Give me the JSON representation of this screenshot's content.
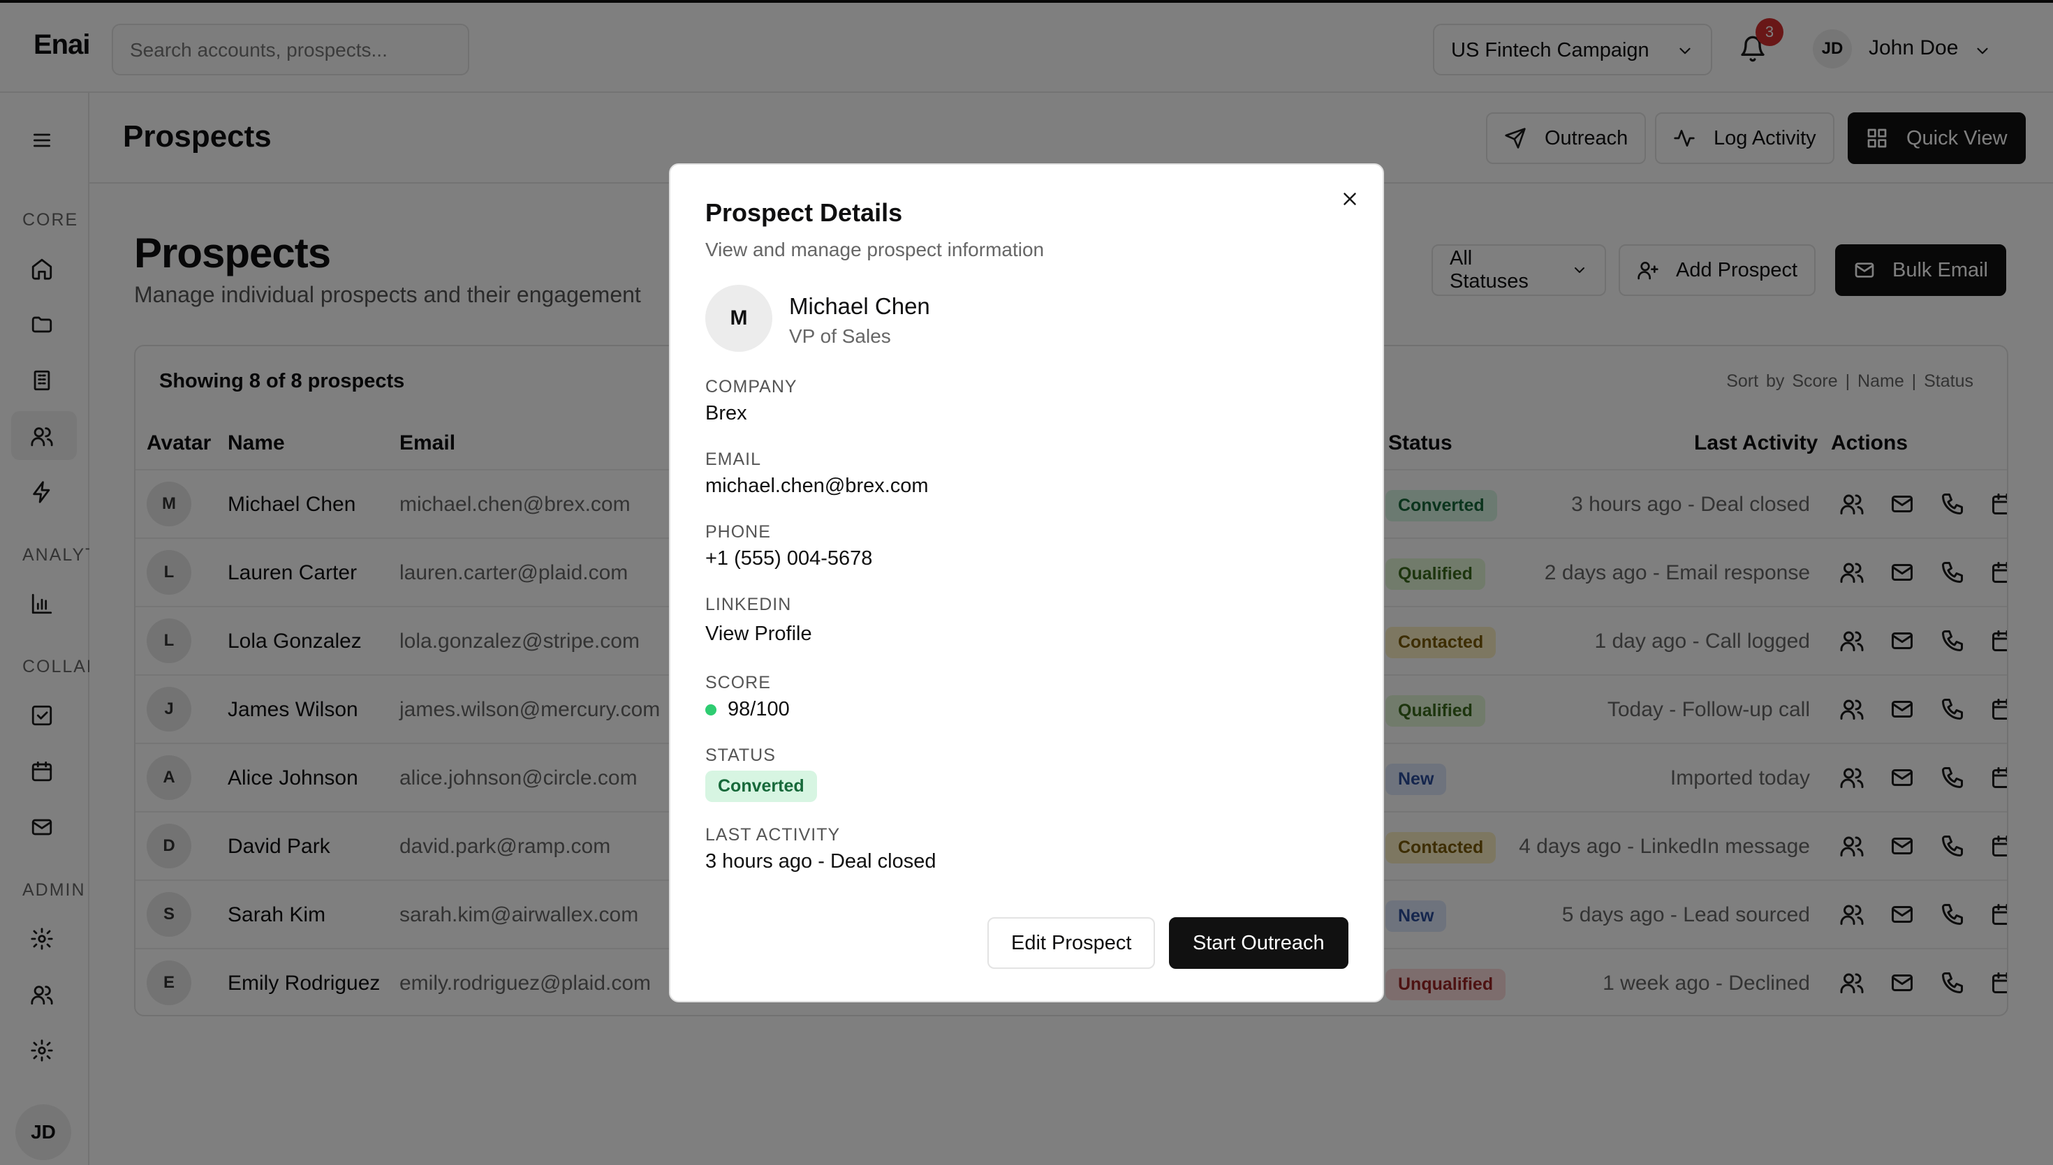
{
  "app": {
    "logo": "Enai"
  },
  "topbar": {
    "search_placeholder": "Search accounts, prospects...",
    "campaign": "US Fintech Campaign",
    "notifications": "3",
    "user_initials": "JD",
    "user_name": "John Doe"
  },
  "sidebar": {
    "sections": [
      "CORE",
      "ANALYT",
      "COLLAB",
      "ADMIN"
    ],
    "items": [
      "home-icon",
      "folder-icon",
      "building-icon",
      "users-icon",
      "zap-icon",
      "chart-icon",
      "check-square-icon",
      "calendar-icon",
      "mail-icon",
      "settings-icon",
      "users-icon",
      "settings-icon"
    ],
    "footer_initials": "JD"
  },
  "page_header": {
    "title": "Prospects",
    "buttons": [
      "Outreach",
      "Log Activity",
      "Quick View"
    ]
  },
  "content": {
    "title": "Prospects",
    "subtitle": "Manage individual prospects and their engagement",
    "status_filter": "All Statuses",
    "add_button": "Add Prospect",
    "bulk_button": "Bulk Email",
    "showing": "Showing 8 of 8 prospects",
    "sort_text": "Sort by Score  |  Name  |  Status"
  },
  "table": {
    "headers": {
      "avatar": "Avatar",
      "name": "Name",
      "email": "Email",
      "status": "Status",
      "last_activity": "Last Activity",
      "actions": "Actions"
    },
    "rows": [
      {
        "initial": "M",
        "name": "Michael Chen",
        "email": "michael.chen@brex.com",
        "status": "Converted",
        "activity": "3 hours ago - Deal closed"
      },
      {
        "initial": "L",
        "name": "Lauren Carter",
        "email": "lauren.carter@plaid.com",
        "status": "Qualified",
        "activity": "2 days ago - Email response"
      },
      {
        "initial": "L",
        "name": "Lola Gonzalez",
        "email": "lola.gonzalez@stripe.com",
        "status": "Contacted",
        "activity": "1 day ago - Call logged"
      },
      {
        "initial": "J",
        "name": "James Wilson",
        "email": "james.wilson@mercury.com",
        "status": "Qualified",
        "activity": "Today - Follow-up call"
      },
      {
        "initial": "A",
        "name": "Alice Johnson",
        "email": "alice.johnson@circle.com",
        "status": "New",
        "activity": "Imported today"
      },
      {
        "initial": "D",
        "name": "David Park",
        "email": "david.park@ramp.com",
        "status": "Contacted",
        "activity": "4 days ago - LinkedIn message"
      },
      {
        "initial": "S",
        "name": "Sarah Kim",
        "email": "sarah.kim@airwallex.com",
        "status": "New",
        "activity": "5 days ago - Lead sourced"
      },
      {
        "initial": "E",
        "name": "Emily Rodriguez",
        "email": "emily.rodriguez@plaid.com",
        "status": "Unqualified",
        "activity": "1 week ago - Declined"
      }
    ]
  },
  "status_colors": {
    "Converted": "#d7f5e2",
    "Qualified": "#e2f7d6",
    "Contacted": "#fbefc2",
    "New": "#dde7fb",
    "Unqualified": "#fbdada"
  },
  "modal": {
    "title": "Prospect Details",
    "subtitle": "View and manage prospect information",
    "initial": "M",
    "name": "Michael Chen",
    "role": "VP of Sales",
    "company_label": "COMPANY",
    "company": "Brex",
    "email_label": "EMAIL",
    "email": "michael.chen@brex.com",
    "phone_label": "PHONE",
    "phone": "+1 (555) 004-5678",
    "linkedin_label": "LINKEDIN",
    "linkedin": "View Profile",
    "score_label": "SCORE",
    "score": "98/100",
    "status_label": "STATUS",
    "status": "Converted",
    "last_activity_label": "LAST ACTIVITY",
    "last_activity": "3 hours ago - Deal closed",
    "edit_button": "Edit Prospect",
    "outreach_button": "Start Outreach"
  }
}
